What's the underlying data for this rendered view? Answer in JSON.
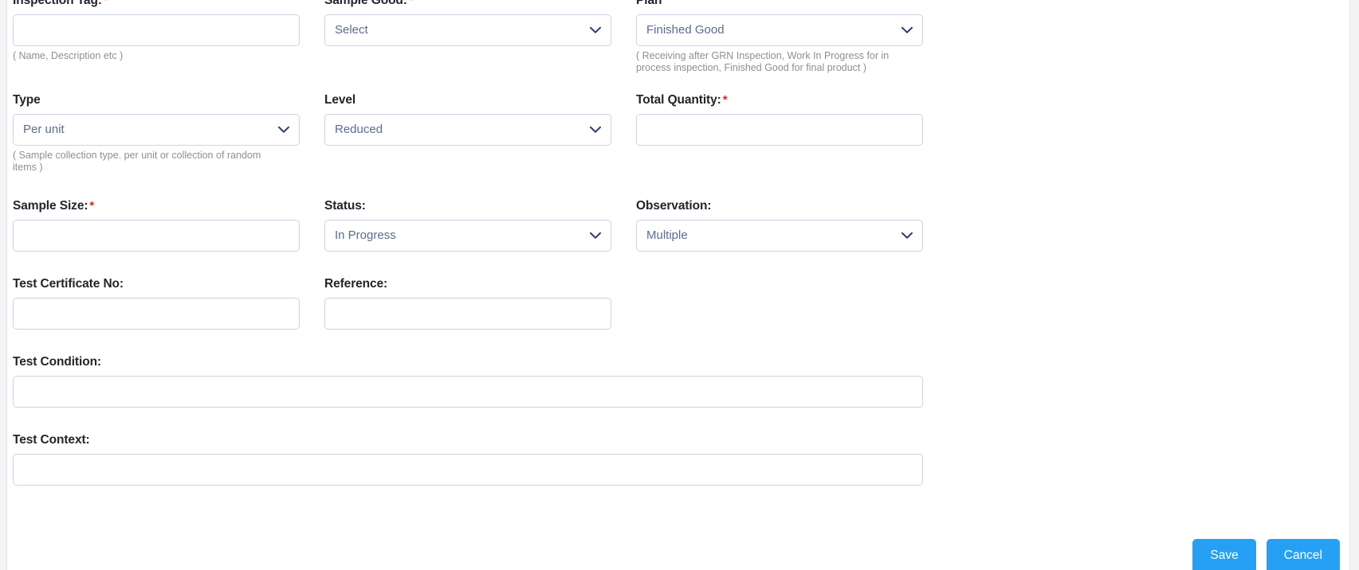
{
  "theme": {
    "accent": "#26a0f5",
    "required_marker_color": "#f01e1e",
    "label_color": "#22252a",
    "input_border": "#ced3e5",
    "input_text": "#5b6b93",
    "hint_color": "#8d8f96"
  },
  "form": {
    "inspection_tag": {
      "label": "Inspection Tag:",
      "required": "*",
      "value": "",
      "placeholder": "",
      "hint": "( Name, Description etc )"
    },
    "sample_good": {
      "label": "Sample Good:",
      "required": "*",
      "value": "Select",
      "icon": "chevron-down-icon"
    },
    "plan": {
      "label": "Plan",
      "value": "Finished Good",
      "icon": "chevron-down-icon",
      "hint": "( Receiving after GRN Inspection, Work In Progress for in process inspection, Finished Good for final product )"
    },
    "type": {
      "label": "Type",
      "value": "Per unit",
      "icon": "chevron-down-icon",
      "hint": "( Sample collection type. per unit or collection of random items )"
    },
    "level": {
      "label": "Level",
      "value": "Reduced",
      "icon": "chevron-down-icon"
    },
    "total_quantity": {
      "label": "Total Quantity:",
      "required": "*",
      "value": "",
      "placeholder": ""
    },
    "sample_size": {
      "label": "Sample Size:",
      "required": "*",
      "value": "",
      "placeholder": ""
    },
    "status": {
      "label": "Status:",
      "value": "In Progress",
      "icon": "chevron-down-icon"
    },
    "observation": {
      "label": "Observation:",
      "value": "Multiple",
      "icon": "chevron-down-icon"
    },
    "test_certificate_no": {
      "label": "Test Certificate No:",
      "value": "",
      "placeholder": ""
    },
    "reference": {
      "label": "Reference:",
      "value": "",
      "placeholder": ""
    },
    "test_condition": {
      "label": "Test Condition:",
      "value": "",
      "placeholder": ""
    },
    "test_context": {
      "label": "Test Context:",
      "value": "",
      "placeholder": ""
    }
  },
  "actions": {
    "save_label": "Save",
    "cancel_label": "Cancel"
  }
}
